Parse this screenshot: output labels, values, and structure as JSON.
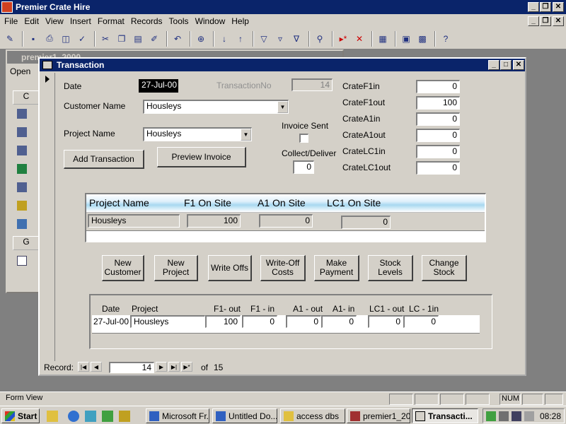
{
  "app": {
    "title": "Premier Crate Hire",
    "menu": [
      "File",
      "Edit",
      "View",
      "Insert",
      "Format",
      "Records",
      "Tools",
      "Window",
      "Help"
    ]
  },
  "db_window": {
    "title": "premier1_2000",
    "open_label": "Open",
    "group_label": "G",
    "objects_label": "C"
  },
  "form": {
    "title": "Transaction",
    "date_label": "Date",
    "date_value": "27-Jul-00",
    "transno_label": "TransactionNo",
    "transno_value": "14",
    "customer_label": "Customer Name",
    "customer_value": "Housleys",
    "project_label": "Project Name",
    "project_value": "Housleys",
    "invoice_sent_label": "Invoice Sent",
    "collect_label": "Collect/Deliver",
    "collect_value": "0",
    "add_transaction": "Add Transaction",
    "preview_invoice": "Preview Invoice",
    "crates": [
      {
        "label": "CrateF1in",
        "value": "0"
      },
      {
        "label": "CrateF1out",
        "value": "100"
      },
      {
        "label": "CrateA1in",
        "value": "0"
      },
      {
        "label": "CrateA1out",
        "value": "0"
      },
      {
        "label": "CrateLC1in",
        "value": "0"
      },
      {
        "label": "CrateLC1out",
        "value": "0"
      }
    ],
    "onsite": {
      "headers": [
        "Project Name",
        "F1 On Site",
        "A1 On Site",
        "LC1 On Site"
      ],
      "row": [
        "Housleys",
        "100",
        "0",
        "0"
      ]
    },
    "buttons": [
      "New\nCustomer",
      "New\nProject",
      "Write Offs",
      "Write-Off\nCosts",
      "Make\nPayment",
      "Stock\nLevels",
      "Change\nStock"
    ],
    "detail": {
      "headers": [
        "Date",
        "Project",
        "F1- out",
        "F1 - in",
        "A1 - out",
        "A1- in",
        "LC1 - out",
        "LC - 1in"
      ],
      "row": [
        "27-Jul-00",
        "Housleys",
        "100",
        "0",
        "0",
        "0",
        "0",
        "0"
      ]
    },
    "nav": {
      "record_label": "Record:",
      "current": "14",
      "of_label": "of",
      "total": "15"
    }
  },
  "status": {
    "text": "Form View",
    "num": "NUM"
  },
  "taskbar": {
    "start": "Start",
    "tasks": [
      "Microsoft Fr...",
      "Untitled Do...",
      "access dbs",
      "premier1_20...",
      "Transacti..."
    ],
    "clock": "08:28"
  }
}
